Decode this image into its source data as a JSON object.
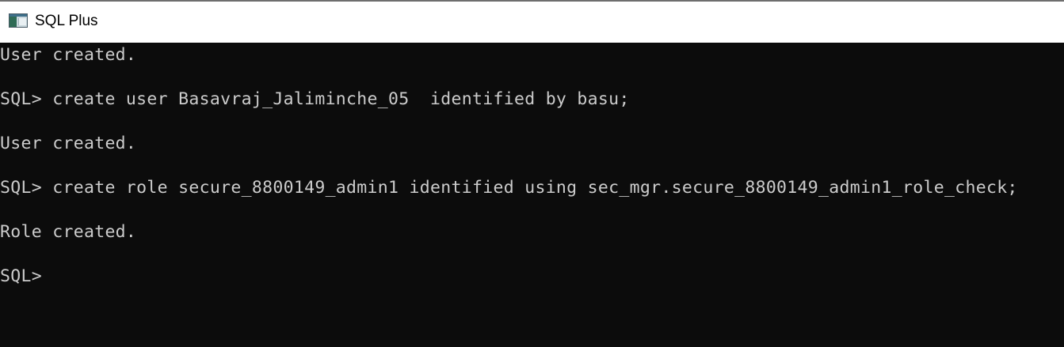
{
  "window": {
    "title": "SQL Plus",
    "icon": "sqlplus-app-icon"
  },
  "console": {
    "lines": [
      "User created.",
      "",
      "SQL> create user Basavraj_Jaliminche_05  identified by basu;",
      "",
      "User created.",
      "",
      "SQL> create role secure_8800149_admin1 identified using sec_mgr.secure_8800149_admin1_role_check;",
      "",
      "Role created.",
      "",
      "SQL>"
    ],
    "colors": {
      "background": "#0c0c0c",
      "text": "#cccccc"
    }
  }
}
